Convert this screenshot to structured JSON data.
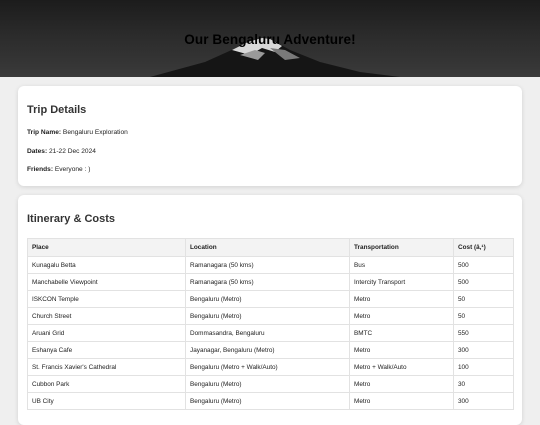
{
  "header": {
    "title": "Our Bengaluru Adventure!"
  },
  "trip": {
    "heading": "Trip Details",
    "details": [
      {
        "label": "Trip Name:",
        "value": "Bengaluru Exploration"
      },
      {
        "label": "Dates:",
        "value": "21-22 Dec 2024"
      },
      {
        "label": "Friends:",
        "value": "Everyone : )"
      }
    ]
  },
  "itinerary": {
    "heading": "Itinerary & Costs",
    "columns": [
      "Place",
      "Location",
      "Transportation",
      "Cost (â‚¹)"
    ],
    "rows": [
      [
        "Kunagalu Betta",
        "Ramanagara (50 kms)",
        "Bus",
        "500"
      ],
      [
        "Manchabelle Viewpoint",
        "Ramanagara (50 kms)",
        "Intercity Transport",
        "500"
      ],
      [
        "ISKCON Temple",
        "Bengaluru (Metro)",
        "Metro",
        "50"
      ],
      [
        "Church Street",
        "Bengaluru (Metro)",
        "Metro",
        "50"
      ],
      [
        "Aruani Grid",
        "Dommasandra, Bengaluru",
        "BMTC",
        "550"
      ],
      [
        "Eshanya Cafe",
        "Jayanagar, Bengaluru (Metro)",
        "Metro",
        "300"
      ],
      [
        "St. Francis Xavier's Cathedral",
        "Bengaluru (Metro + Walk/Auto)",
        "Metro + Walk/Auto",
        "100"
      ],
      [
        "Cubbon Park",
        "Bengaluru (Metro)",
        "Metro",
        "30"
      ],
      [
        "UB City",
        "Bengaluru (Metro)",
        "Metro",
        "300"
      ]
    ]
  }
}
